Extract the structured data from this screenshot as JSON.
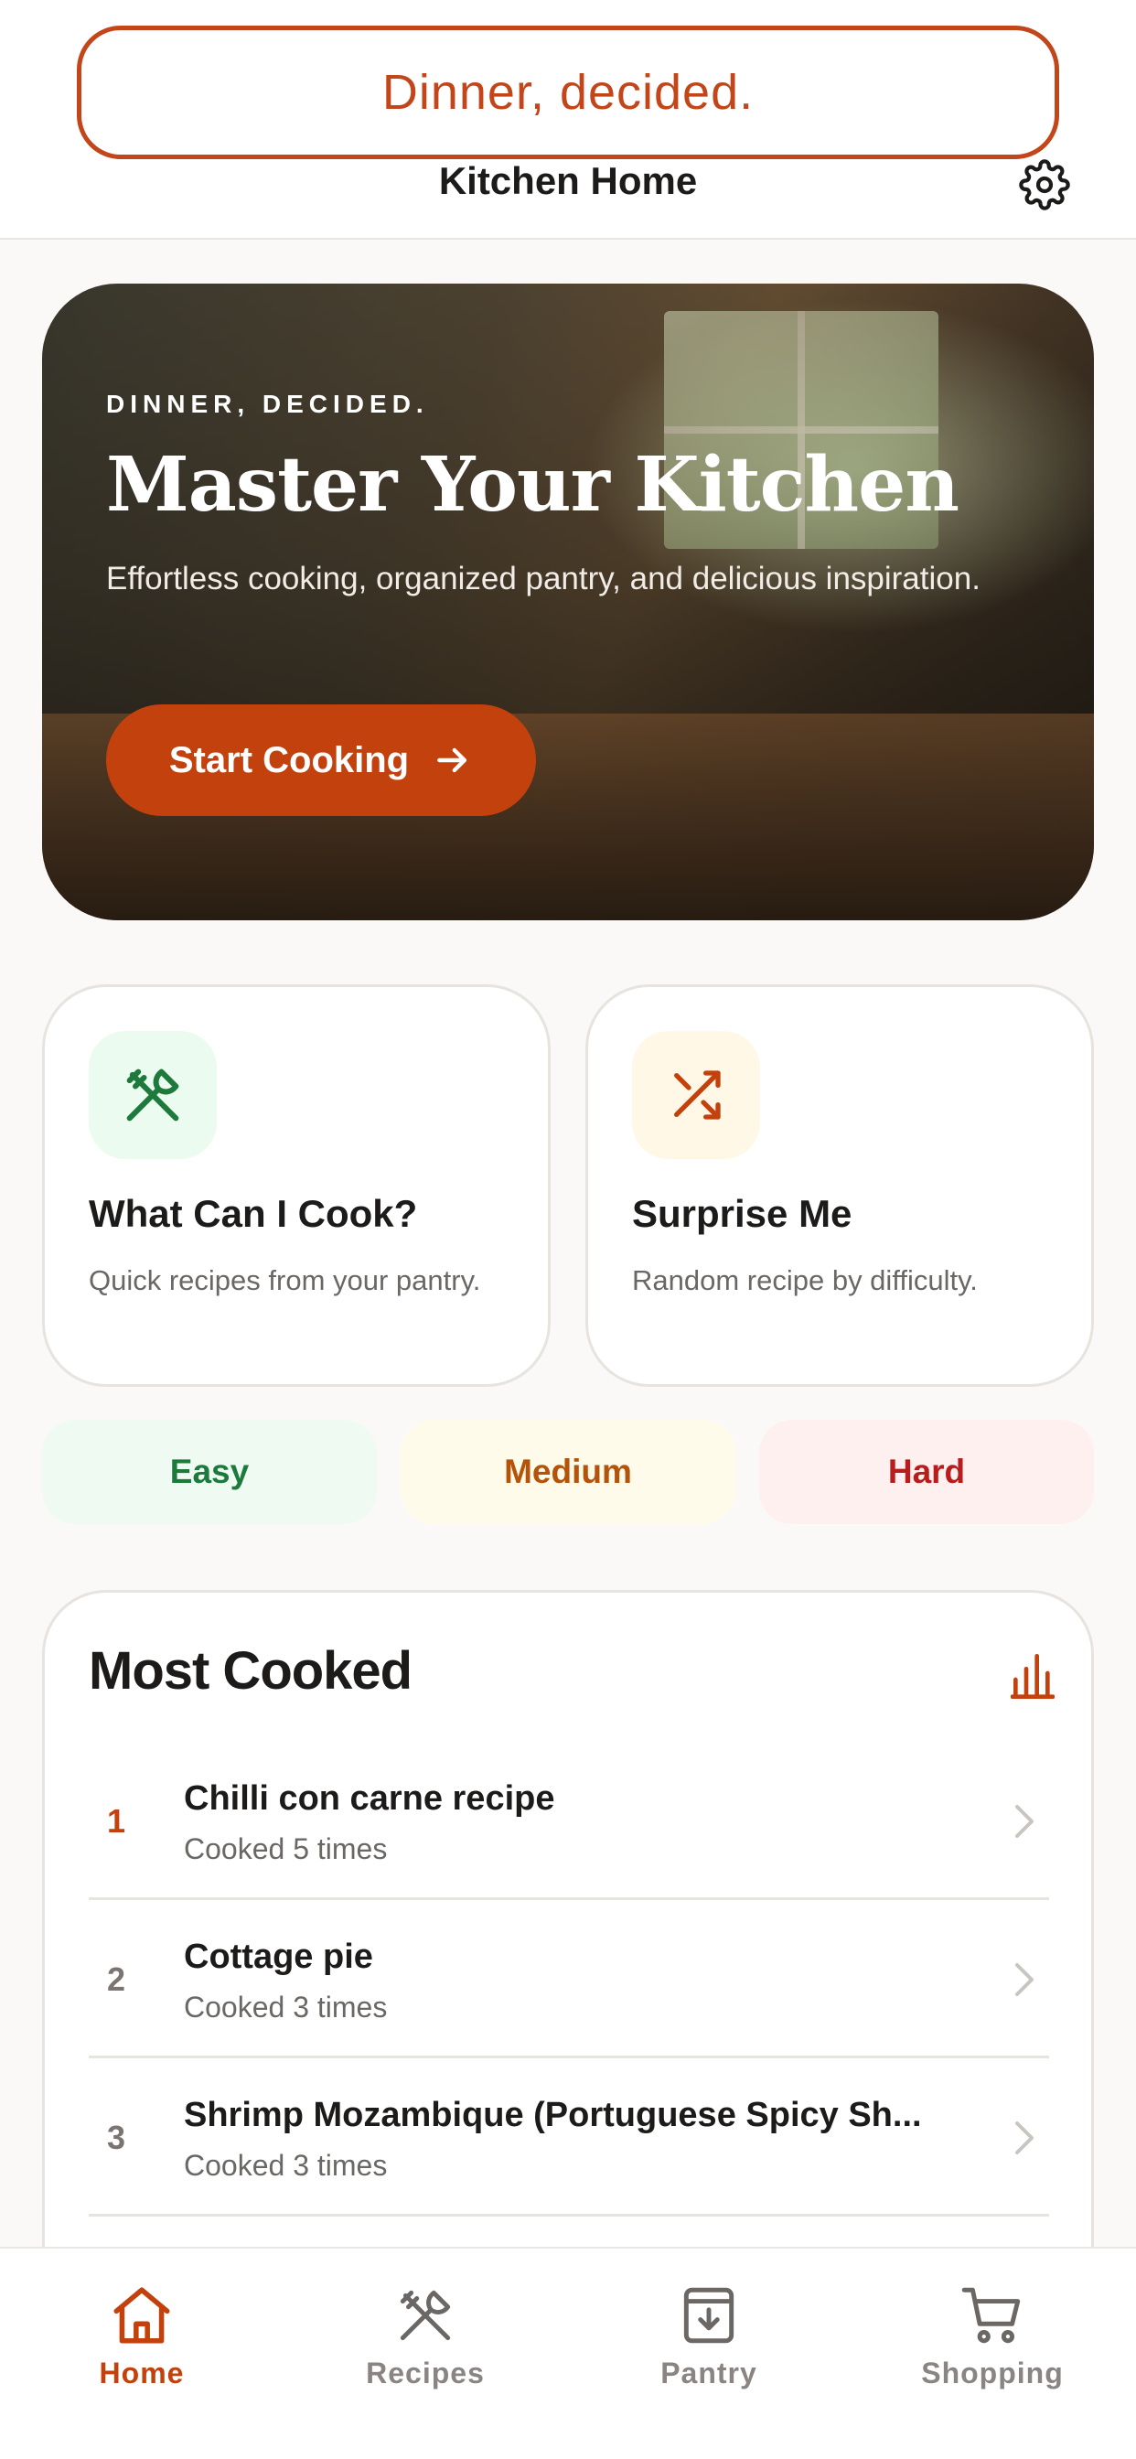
{
  "header": {
    "tagline": "Dinner, decided.",
    "title": "Kitchen Home",
    "settings_icon": "gear-icon"
  },
  "hero": {
    "kicker": "DINNER, DECIDED.",
    "title": "Master Your Kitchen",
    "subtitle": "Effortless cooking, organized pantry, and delicious inspiration.",
    "cta_label": "Start Cooking",
    "cta_icon": "arrow-right-icon"
  },
  "features": [
    {
      "title": "What Can I Cook?",
      "description": "Quick recipes from your pantry.",
      "icon": "utensils-icon",
      "icon_bg": "#ecfbf0",
      "icon_color": "#1e7a3c"
    },
    {
      "title": "Surprise Me",
      "description": "Random recipe by difficulty.",
      "icon": "shuffle-icon",
      "icon_bg": "#fff8e6",
      "icon_color": "#c2410c"
    }
  ],
  "difficulty": [
    {
      "label": "Easy",
      "color": "#1e7a3c"
    },
    {
      "label": "Medium",
      "color": "#b4530a"
    },
    {
      "label": "Hard",
      "color": "#b91c1c"
    }
  ],
  "most_cooked": {
    "title": "Most Cooked",
    "chart_icon": "bar-chart-icon",
    "items": [
      {
        "rank": "1",
        "name": "Chilli con carne recipe",
        "count": "Cooked 5 times"
      },
      {
        "rank": "2",
        "name": "Cottage pie",
        "count": "Cooked 3 times"
      },
      {
        "rank": "3",
        "name": "Shrimp Mozambique (Portuguese Spicy Sh...",
        "count": "Cooked 3 times"
      }
    ]
  },
  "tabs": [
    {
      "label": "Home",
      "icon": "home-icon",
      "active": true
    },
    {
      "label": "Recipes",
      "icon": "utensils-icon",
      "active": false
    },
    {
      "label": "Pantry",
      "icon": "archive-box-icon",
      "active": false
    },
    {
      "label": "Shopping",
      "icon": "cart-icon",
      "active": false
    }
  ],
  "colors": {
    "accent": "#c2410c",
    "background": "#fbf9f7",
    "card_border": "#e7e4e0"
  }
}
